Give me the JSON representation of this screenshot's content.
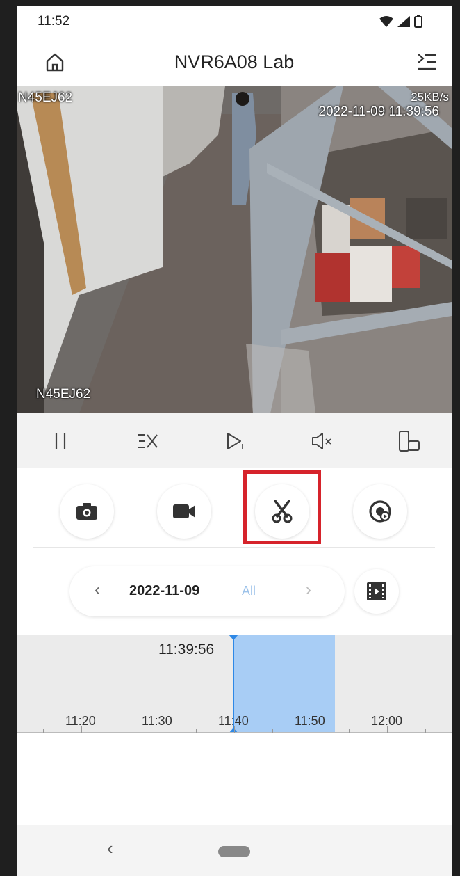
{
  "status_bar": {
    "time": "11:52"
  },
  "app_bar": {
    "title": "NVR6A08 Lab"
  },
  "video": {
    "channel_top": "N45EJ62",
    "channel_bottom": "N45EJ62",
    "bitrate": "25KB/s",
    "timestamp": "2022-11-09 11:39:56"
  },
  "controls": [
    "pause-icon",
    "speed-icon",
    "frame-step-icon",
    "mute-icon",
    "rotate-screen-icon"
  ],
  "actions": [
    "camera-icon",
    "video-record-icon",
    "scissors-icon",
    "playback-icon"
  ],
  "date_selector": {
    "date": "2022-11-09",
    "filter": "All",
    "prev": "‹",
    "next": "›"
  },
  "timeline": {
    "current_time": "11:39:56",
    "labels": [
      "11:20",
      "11:30",
      "11:40",
      "11:50",
      "12:00"
    ]
  },
  "colors": {
    "selection": "#a8cdf5",
    "highlight": "#d6232b",
    "accent": "#2e88e6"
  }
}
